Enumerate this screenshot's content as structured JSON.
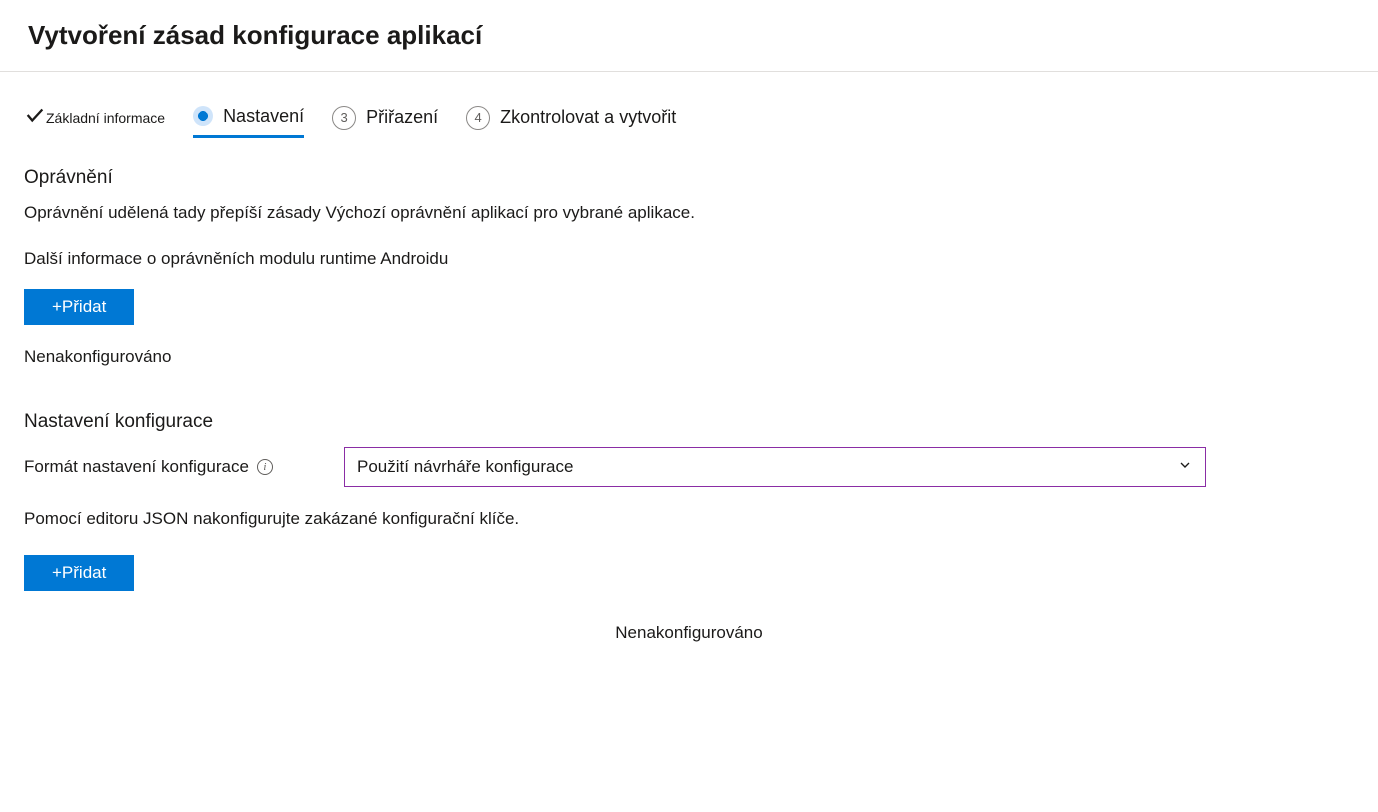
{
  "header": {
    "title": "Vytvoření zásad konfigurace aplikací"
  },
  "wizard": {
    "step1": {
      "label": "Základní informace"
    },
    "step2": {
      "label": "Nastavení"
    },
    "step3": {
      "num": "3",
      "label": "Přiřazení"
    },
    "step4": {
      "num": "4",
      "label": "Zkontrolovat a vytvořit"
    }
  },
  "permissions": {
    "title": "Oprávnění",
    "desc": "Oprávnění udělená tady přepíší zásady Výchozí oprávnění aplikací pro vybrané aplikace.",
    "link": "Další informace o oprávněních modulu runtime Androidu",
    "add": "+Přidat",
    "not_configured": "Nenakonfigurováno"
  },
  "config": {
    "title": "Nastavení konfigurace",
    "format_label": "Formát nastavení konfigurace",
    "selected": "Použití návrháře konfigurace",
    "json_hint": "Pomocí editoru JSON nakonfigurujte zakázané konfigurační klíče.",
    "add": "+Přidat",
    "not_configured": "Nenakonfigurováno"
  }
}
